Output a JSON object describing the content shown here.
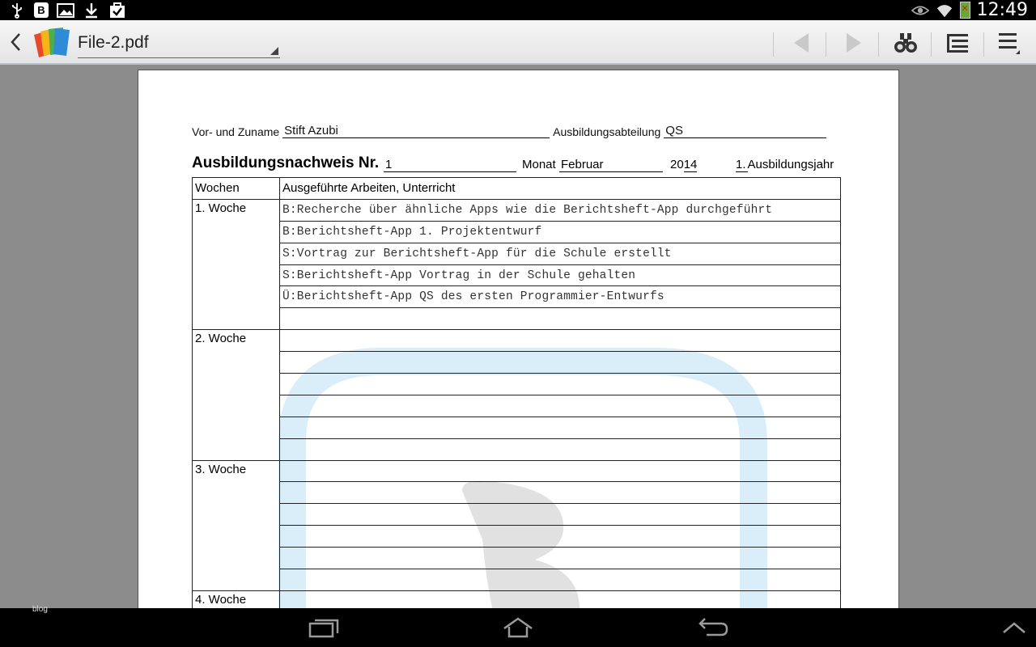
{
  "status_bar": {
    "left_icons": [
      "usb-icon",
      "b-app-icon",
      "gallery-icon",
      "download-icon",
      "task-icon"
    ],
    "b_label": "B",
    "time": "12:49"
  },
  "action_bar": {
    "file_title": "File-2.pdf",
    "buttons": [
      "prev-page",
      "next-page",
      "find",
      "outline",
      "menu"
    ]
  },
  "document": {
    "name_label": "Vor- und Zuname",
    "name_value": "Stift Azubi",
    "dept_label": "Ausbildungsabteilung",
    "dept_value": "QS",
    "heading": "Ausbildungsnachweis Nr.",
    "number": "1",
    "month_label": "Monat",
    "month_value": "Februar",
    "year_prefix": "20",
    "year_suffix": "14",
    "training_year_num": "1.",
    "training_year_label": "Ausbildungsjahr",
    "table_header": [
      "Wochen",
      "Ausgeführte Arbeiten, Unterricht"
    ],
    "weeks": [
      {
        "label": "1. Woche",
        "entries": [
          "B:Recherche über ähnliche Apps wie die Berichtsheft-App durchgeführt",
          "B:Berichtsheft-App 1. Projektentwurf",
          "S:Vortrag zur Berichtsheft-App für die Schule erstellt",
          "S:Berichtsheft-App Vortrag in der Schule gehalten",
          "Ü:Berichtsheft-App QS des ersten Programmier-Entwurfs",
          ""
        ]
      },
      {
        "label": "2. Woche",
        "entries": [
          "",
          "",
          "",
          "",
          "",
          ""
        ]
      },
      {
        "label": "3. Woche",
        "entries": [
          "",
          "",
          "",
          "",
          "",
          ""
        ]
      },
      {
        "label": "4. Woche",
        "entries": [
          ""
        ]
      }
    ]
  },
  "nav_bar": {
    "corner_text": "blog",
    "buttons": [
      "recent-apps",
      "home",
      "back",
      "expand"
    ]
  },
  "colors": {
    "accent_light_blue": "#dbeef8",
    "watermark_gray": "#e2e2e2",
    "chrome_gray": "#8c8c8c"
  }
}
